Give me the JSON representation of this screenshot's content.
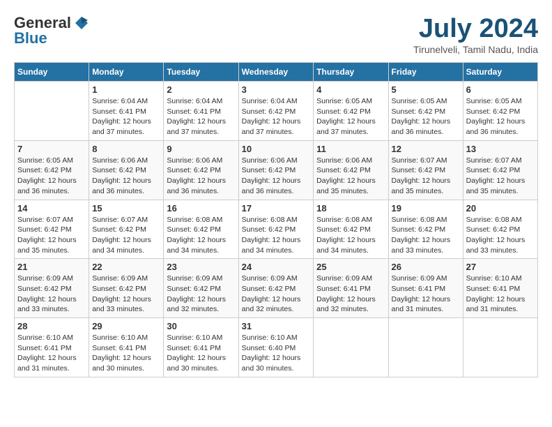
{
  "logo": {
    "general": "General",
    "blue": "Blue"
  },
  "title": "July 2024",
  "location": "Tirunelveli, Tamil Nadu, India",
  "days_of_week": [
    "Sunday",
    "Monday",
    "Tuesday",
    "Wednesday",
    "Thursday",
    "Friday",
    "Saturday"
  ],
  "weeks": [
    [
      {
        "day": "",
        "sunrise": "",
        "sunset": "",
        "daylight": ""
      },
      {
        "day": "1",
        "sunrise": "6:04 AM",
        "sunset": "6:41 PM",
        "daylight": "12 hours and 37 minutes."
      },
      {
        "day": "2",
        "sunrise": "6:04 AM",
        "sunset": "6:41 PM",
        "daylight": "12 hours and 37 minutes."
      },
      {
        "day": "3",
        "sunrise": "6:04 AM",
        "sunset": "6:42 PM",
        "daylight": "12 hours and 37 minutes."
      },
      {
        "day": "4",
        "sunrise": "6:05 AM",
        "sunset": "6:42 PM",
        "daylight": "12 hours and 37 minutes."
      },
      {
        "day": "5",
        "sunrise": "6:05 AM",
        "sunset": "6:42 PM",
        "daylight": "12 hours and 36 minutes."
      },
      {
        "day": "6",
        "sunrise": "6:05 AM",
        "sunset": "6:42 PM",
        "daylight": "12 hours and 36 minutes."
      }
    ],
    [
      {
        "day": "7",
        "sunrise": "6:05 AM",
        "sunset": "6:42 PM",
        "daylight": "12 hours and 36 minutes."
      },
      {
        "day": "8",
        "sunrise": "6:06 AM",
        "sunset": "6:42 PM",
        "daylight": "12 hours and 36 minutes."
      },
      {
        "day": "9",
        "sunrise": "6:06 AM",
        "sunset": "6:42 PM",
        "daylight": "12 hours and 36 minutes."
      },
      {
        "day": "10",
        "sunrise": "6:06 AM",
        "sunset": "6:42 PM",
        "daylight": "12 hours and 36 minutes."
      },
      {
        "day": "11",
        "sunrise": "6:06 AM",
        "sunset": "6:42 PM",
        "daylight": "12 hours and 35 minutes."
      },
      {
        "day": "12",
        "sunrise": "6:07 AM",
        "sunset": "6:42 PM",
        "daylight": "12 hours and 35 minutes."
      },
      {
        "day": "13",
        "sunrise": "6:07 AM",
        "sunset": "6:42 PM",
        "daylight": "12 hours and 35 minutes."
      }
    ],
    [
      {
        "day": "14",
        "sunrise": "6:07 AM",
        "sunset": "6:42 PM",
        "daylight": "12 hours and 35 minutes."
      },
      {
        "day": "15",
        "sunrise": "6:07 AM",
        "sunset": "6:42 PM",
        "daylight": "12 hours and 34 minutes."
      },
      {
        "day": "16",
        "sunrise": "6:08 AM",
        "sunset": "6:42 PM",
        "daylight": "12 hours and 34 minutes."
      },
      {
        "day": "17",
        "sunrise": "6:08 AM",
        "sunset": "6:42 PM",
        "daylight": "12 hours and 34 minutes."
      },
      {
        "day": "18",
        "sunrise": "6:08 AM",
        "sunset": "6:42 PM",
        "daylight": "12 hours and 34 minutes."
      },
      {
        "day": "19",
        "sunrise": "6:08 AM",
        "sunset": "6:42 PM",
        "daylight": "12 hours and 33 minutes."
      },
      {
        "day": "20",
        "sunrise": "6:08 AM",
        "sunset": "6:42 PM",
        "daylight": "12 hours and 33 minutes."
      }
    ],
    [
      {
        "day": "21",
        "sunrise": "6:09 AM",
        "sunset": "6:42 PM",
        "daylight": "12 hours and 33 minutes."
      },
      {
        "day": "22",
        "sunrise": "6:09 AM",
        "sunset": "6:42 PM",
        "daylight": "12 hours and 33 minutes."
      },
      {
        "day": "23",
        "sunrise": "6:09 AM",
        "sunset": "6:42 PM",
        "daylight": "12 hours and 32 minutes."
      },
      {
        "day": "24",
        "sunrise": "6:09 AM",
        "sunset": "6:42 PM",
        "daylight": "12 hours and 32 minutes."
      },
      {
        "day": "25",
        "sunrise": "6:09 AM",
        "sunset": "6:41 PM",
        "daylight": "12 hours and 32 minutes."
      },
      {
        "day": "26",
        "sunrise": "6:09 AM",
        "sunset": "6:41 PM",
        "daylight": "12 hours and 31 minutes."
      },
      {
        "day": "27",
        "sunrise": "6:10 AM",
        "sunset": "6:41 PM",
        "daylight": "12 hours and 31 minutes."
      }
    ],
    [
      {
        "day": "28",
        "sunrise": "6:10 AM",
        "sunset": "6:41 PM",
        "daylight": "12 hours and 31 minutes."
      },
      {
        "day": "29",
        "sunrise": "6:10 AM",
        "sunset": "6:41 PM",
        "daylight": "12 hours and 30 minutes."
      },
      {
        "day": "30",
        "sunrise": "6:10 AM",
        "sunset": "6:41 PM",
        "daylight": "12 hours and 30 minutes."
      },
      {
        "day": "31",
        "sunrise": "6:10 AM",
        "sunset": "6:40 PM",
        "daylight": "12 hours and 30 minutes."
      },
      {
        "day": "",
        "sunrise": "",
        "sunset": "",
        "daylight": ""
      },
      {
        "day": "",
        "sunrise": "",
        "sunset": "",
        "daylight": ""
      },
      {
        "day": "",
        "sunrise": "",
        "sunset": "",
        "daylight": ""
      }
    ]
  ]
}
